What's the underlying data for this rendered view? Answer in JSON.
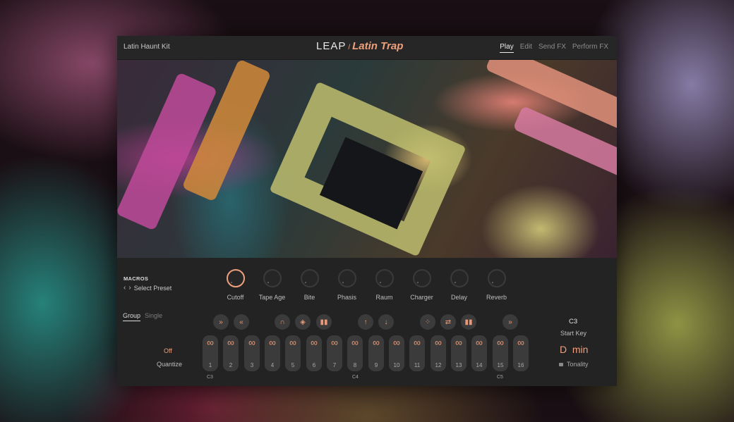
{
  "header": {
    "kit_name": "Latin Haunt Kit",
    "logo_brand": "LEAP",
    "logo_mark": "/",
    "logo_title": "Latin Trap",
    "tabs": [
      "Play",
      "Edit",
      "Send FX",
      "Perform FX"
    ],
    "active_tab": "Play"
  },
  "macros": {
    "title": "MACROS",
    "preset_label": "Select Preset",
    "knobs": [
      {
        "label": "Cutoff"
      },
      {
        "label": "Tape Age"
      },
      {
        "label": "Bite"
      },
      {
        "label": "Phasis"
      },
      {
        "label": "Raum"
      },
      {
        "label": "Charger"
      },
      {
        "label": "Delay"
      },
      {
        "label": "Reverb"
      }
    ]
  },
  "mode_tabs": [
    "Group",
    "Single"
  ],
  "active_mode": "Group",
  "quantize": {
    "value": "Off",
    "label": "Quantize"
  },
  "start_key": {
    "value": "C3",
    "label": "Start Key"
  },
  "tonality": {
    "value": "D  min",
    "label": "Tonality"
  },
  "pads": {
    "numbers": [
      "1",
      "2",
      "3",
      "4",
      "5",
      "6",
      "7",
      "8",
      "9",
      "10",
      "11",
      "12",
      "13",
      "14",
      "15",
      "16"
    ],
    "octave_labels": [
      "C3",
      "C4",
      "C5"
    ]
  },
  "colors": {
    "accent": "#f0a07c",
    "panel": "#242424",
    "pad": "#3b3b3b"
  },
  "icons": {
    "buttons": [
      "fast-forward-icon",
      "rewind-icon",
      "envelope-icon",
      "shuffle-icon",
      "bars-icon",
      "arrow-up-icon",
      "arrow-down-icon",
      "scatter-icon",
      "swap-icon",
      "bars-icon",
      "fast-forward-icon"
    ],
    "pad": "infinity-icon"
  }
}
